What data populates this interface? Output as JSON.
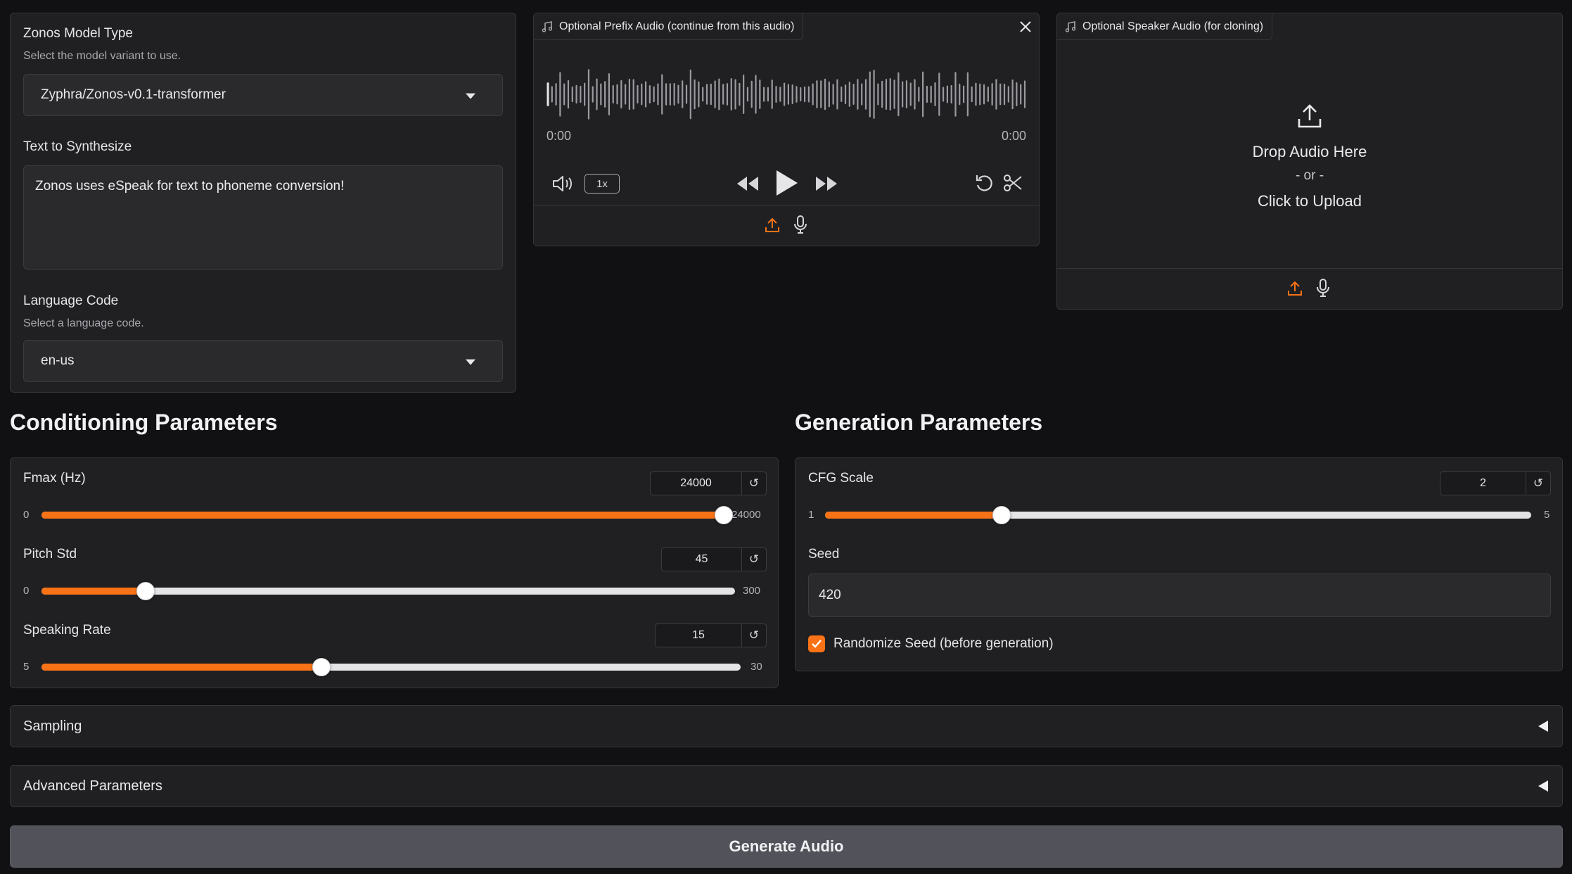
{
  "model": {
    "label": "Zonos Model Type",
    "info": "Select the model variant to use.",
    "value": "Zyphra/Zonos-v0.1-transformer"
  },
  "text": {
    "label": "Text to Synthesize",
    "value": "Zonos uses eSpeak for text to phoneme conversion!"
  },
  "language": {
    "label": "Language Code",
    "info": "Select a language code.",
    "value": "en-us"
  },
  "prefix_audio": {
    "label": "Optional Prefix Audio (continue from this audio)",
    "time_start": "0:00",
    "time_end": "0:00",
    "speed": "1x"
  },
  "speaker_audio": {
    "label": "Optional Speaker Audio (for cloning)",
    "drop_text": "Drop Audio Here",
    "or_text": "- or -",
    "click_text": "Click to Upload"
  },
  "conditioning": {
    "title": "Conditioning Parameters",
    "fmax": {
      "label": "Fmax (Hz)",
      "value": "24000",
      "min": "0",
      "max": "24000",
      "fraction": 1.0
    },
    "pitch_std": {
      "label": "Pitch Std",
      "value": "45",
      "min": "0",
      "max": "300",
      "fraction": 0.15
    },
    "speaking_rate": {
      "label": "Speaking Rate",
      "value": "15",
      "min": "5",
      "max": "30",
      "fraction": 0.4
    }
  },
  "generation": {
    "title": "Generation Parameters",
    "cfg": {
      "label": "CFG Scale",
      "value": "2",
      "min": "1",
      "max": "5",
      "fraction": 0.25
    },
    "seed": {
      "label": "Seed",
      "value": "420"
    },
    "randomize": {
      "label": "Randomize Seed (before generation)",
      "checked": true
    }
  },
  "accordions": {
    "sampling": "Sampling",
    "advanced": "Advanced Parameters"
  },
  "generate_label": "Generate Audio",
  "colors": {
    "accent": "#f97316",
    "panel": "#202022",
    "background": "#111113"
  }
}
